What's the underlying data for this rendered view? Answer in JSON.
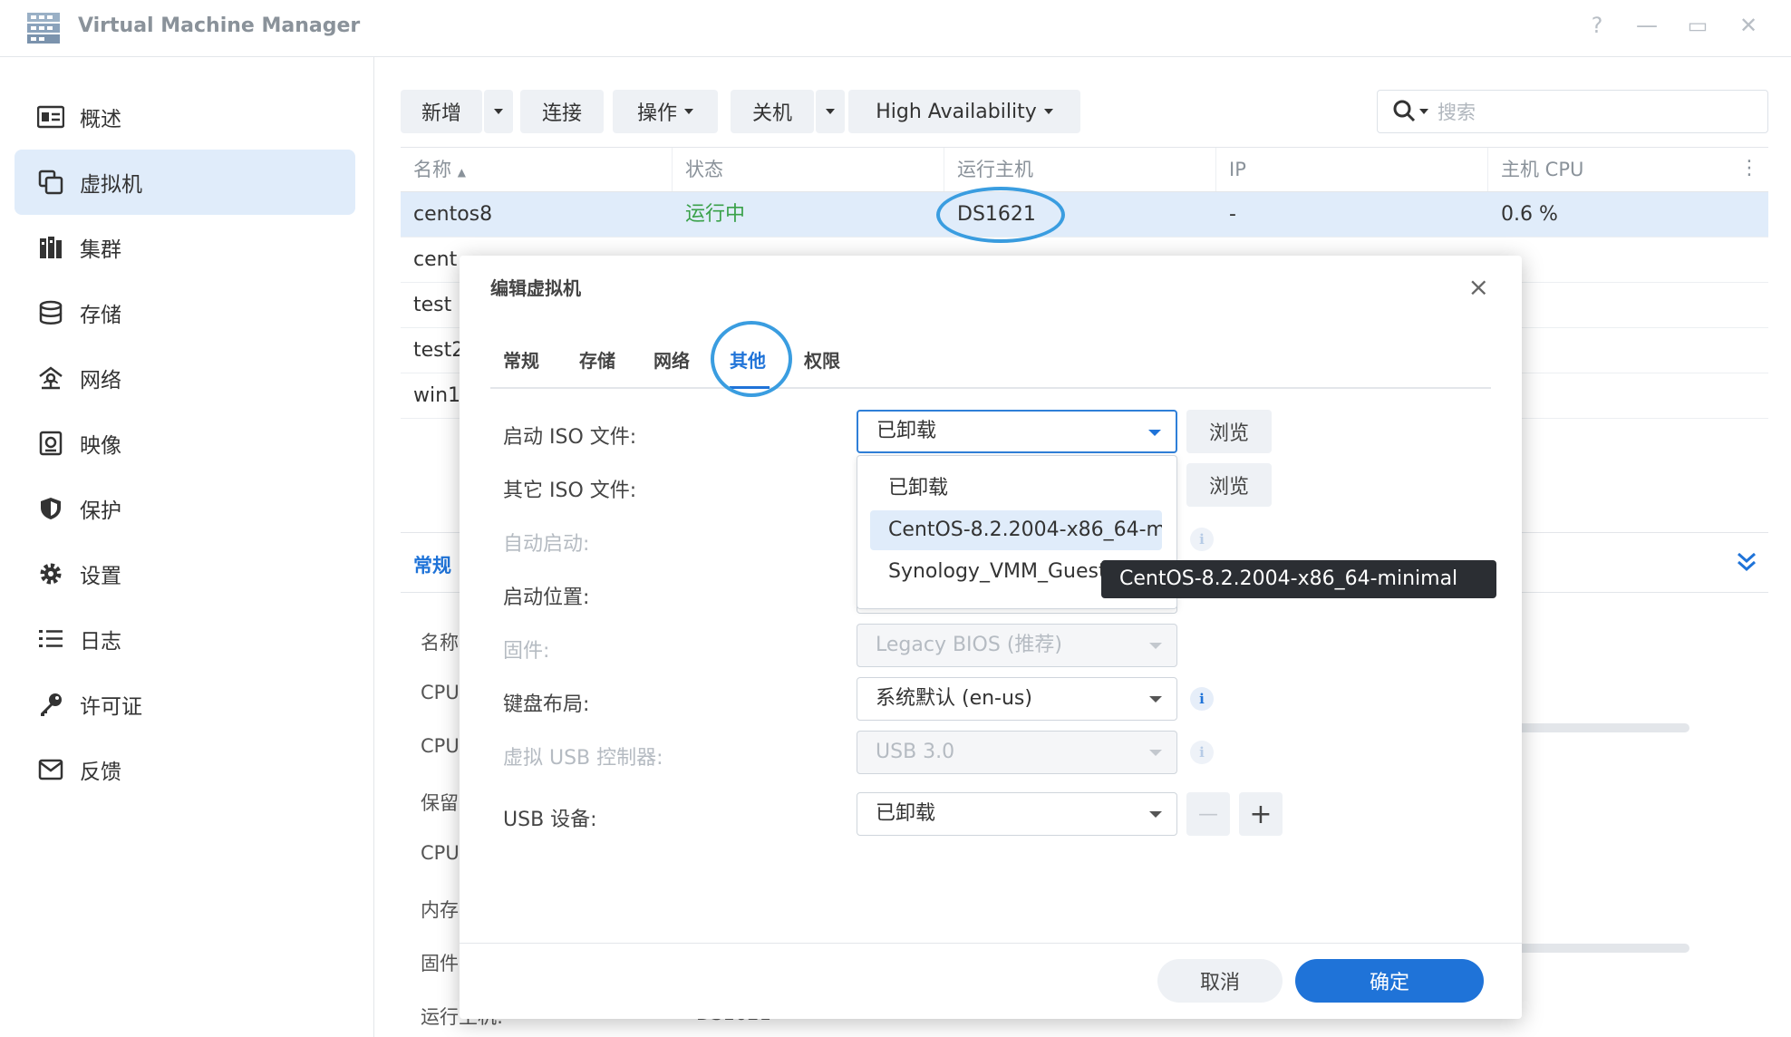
{
  "app": {
    "title": "Virtual Machine Manager",
    "help": "?",
    "minimize": "—",
    "maximize": "▭",
    "close": "✕"
  },
  "sidebar": {
    "items": [
      {
        "label": "概述",
        "icon": "overview-icon"
      },
      {
        "label": "虚拟机",
        "icon": "vm-icon",
        "active": true
      },
      {
        "label": "集群",
        "icon": "cluster-icon"
      },
      {
        "label": "存储",
        "icon": "storage-icon"
      },
      {
        "label": "网络",
        "icon": "network-icon"
      },
      {
        "label": "映像",
        "icon": "image-icon"
      },
      {
        "label": "保护",
        "icon": "shield-icon"
      },
      {
        "label": "设置",
        "icon": "gear-icon"
      },
      {
        "label": "日志",
        "icon": "log-icon"
      },
      {
        "label": "许可证",
        "icon": "key-icon"
      },
      {
        "label": "反馈",
        "icon": "mail-icon"
      }
    ]
  },
  "toolbar": {
    "add": "新增",
    "connect": "连接",
    "action": "操作",
    "shutdown": "关机",
    "ha": "High Availability",
    "search_placeholder": "搜索"
  },
  "grid": {
    "columns": [
      "名称",
      "状态",
      "运行主机",
      "IP",
      "主机 CPU"
    ],
    "rows": [
      {
        "name": "centos8",
        "status": "运行中",
        "host": "DS1621",
        "ip": "-",
        "cpu": "0.6 %"
      },
      {
        "name": "cent"
      },
      {
        "name": "test"
      },
      {
        "name": "test2"
      },
      {
        "name": "win1"
      }
    ]
  },
  "detail": {
    "tab": "常规",
    "labels": [
      "名称",
      "CPU",
      "CPU",
      "保留",
      "CPU",
      "内存",
      "固件",
      "运行主机:"
    ],
    "host_value": "DS1621"
  },
  "modal": {
    "title": "编辑虚拟机",
    "close": "×",
    "tabs": [
      "常规",
      "存储",
      "网络",
      "其他",
      "权限"
    ],
    "active_tab": "其他",
    "fields": {
      "boot_iso": {
        "label": "启动 ISO 文件:",
        "value": "已卸载"
      },
      "other_iso": {
        "label": "其它 ISO 文件:"
      },
      "autostart": {
        "label": "自动启动:"
      },
      "boot_order": {
        "label": "启动位置:"
      },
      "firmware": {
        "label": "固件:",
        "value": "Legacy BIOS (推荐)"
      },
      "keyboard": {
        "label": "键盘布局:",
        "value": "系统默认 (en-us)"
      },
      "usb_controller": {
        "label": "虚拟 USB 控制器:",
        "value": "USB 3.0"
      },
      "usb_device": {
        "label": "USB 设备:",
        "value": "已卸载"
      }
    },
    "browse": "浏览",
    "dropdown_options": [
      "已卸载",
      "CentOS-8.2.2004-x86_64-minimal",
      "Synology_VMM_Guest_Tool"
    ],
    "tooltip": "CentOS-8.2.2004-x86_64-minimal",
    "info": "i",
    "minus": "—",
    "plus": "+",
    "cancel": "取消",
    "ok": "确定"
  },
  "colors": {
    "accent": "#1f73d8",
    "status_running": "#3aa14a",
    "annotation": "#3a9de0"
  }
}
